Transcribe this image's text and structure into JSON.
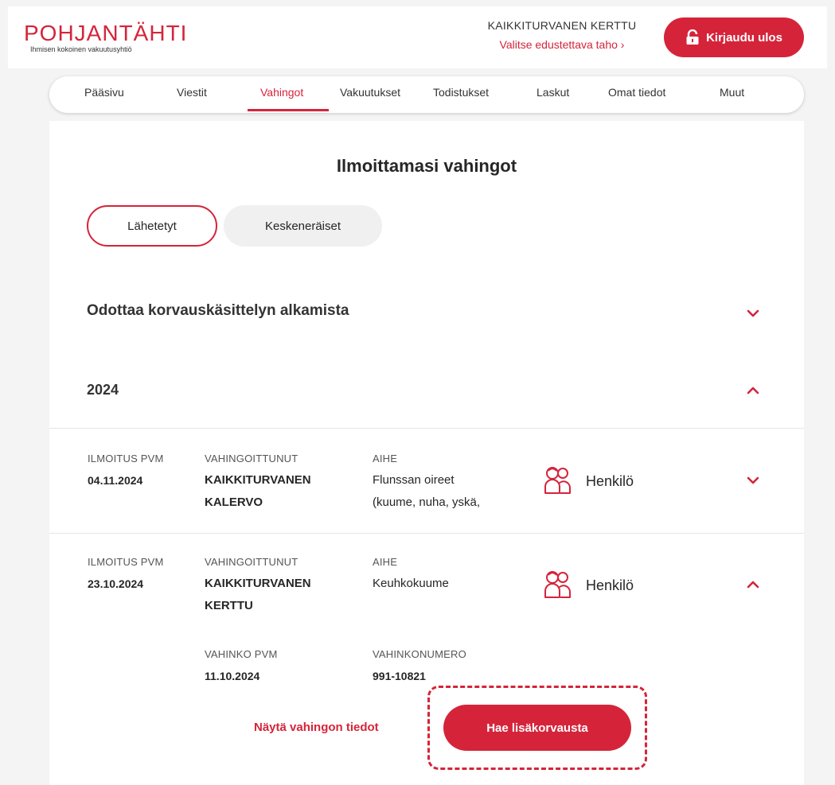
{
  "header": {
    "logo_title": "POHJANTÄHTI",
    "logo_subtitle": "Ihmisen kokoinen vakuutusyhtiö",
    "user_name": "KAIKKITURVANEN KERTTU",
    "choose_representative": "Valitse edustettava taho ›",
    "logout_label": "Kirjaudu ulos"
  },
  "nav": {
    "items": [
      {
        "label": "Pääsivu"
      },
      {
        "label": "Viestit"
      },
      {
        "label": "Vahingot"
      },
      {
        "label": "Vakuutukset"
      },
      {
        "label": "Todistukset"
      },
      {
        "label": "Laskut"
      },
      {
        "label": "Omat tiedot"
      },
      {
        "label": "Muut"
      }
    ],
    "active": "Vahingot"
  },
  "main": {
    "title": "Ilmoittamasi vahingot",
    "tabs": [
      {
        "label": "Lähetetyt",
        "selected": true
      },
      {
        "label": "Keskeneräiset",
        "selected": false
      }
    ],
    "pending_section": {
      "title": "Odottaa korvauskäsittelyn alkamista",
      "expanded": false
    },
    "year_section": {
      "title": "2024",
      "expanded": true
    },
    "labels": {
      "notice_date": "ILMOITUS PVM",
      "injured": "VAHINGOITTUNUT",
      "subject": "AIHE",
      "damage_date": "VAHINKO PVM",
      "damage_number": "VAHINKONUMERO"
    },
    "claims": [
      {
        "notice_date": "04.11.2024",
        "injured_line1": "KAIKKITURVANEN",
        "injured_line2": "KALERVO",
        "subject_line1": "Flunssan oireet",
        "subject_line2": "(kuume, nuha, yskä,",
        "type": "Henkilö",
        "type_icon": "people-icon",
        "expanded": false
      },
      {
        "notice_date": "23.10.2024",
        "injured_line1": "KAIKKITURVANEN",
        "injured_line2": "KERTTU",
        "subject_line1": "Keuhkokuume",
        "type": "Henkilö",
        "type_icon": "people-icon",
        "expanded": true,
        "damage_date": "11.10.2024",
        "damage_number": "991-10821"
      }
    ],
    "show_details_label": "Näytä vahingon tiedot",
    "apply_extra_label": "Hae lisäkorvausta"
  },
  "colors": {
    "accent": "#d5243a",
    "background": "#f4f4f4",
    "panel": "#ffffff"
  }
}
